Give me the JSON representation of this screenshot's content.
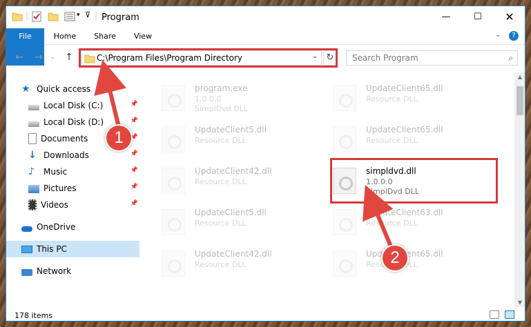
{
  "window": {
    "title": "Program"
  },
  "ribbon": {
    "tabs": [
      "File",
      "Home",
      "Share",
      "View"
    ]
  },
  "address": {
    "path": "C:\\Program Files\\Program Directory"
  },
  "search": {
    "placeholder": "Search Program"
  },
  "nav": {
    "items": [
      {
        "label": "Quick access",
        "icon": "star-icon",
        "pinned": false
      },
      {
        "label": "Local Disk (C:)",
        "icon": "drive-icon",
        "pinned": true
      },
      {
        "label": "Local Disk (D:)",
        "icon": "drive-icon",
        "pinned": true
      },
      {
        "label": "Documents",
        "icon": "document-icon",
        "pinned": true
      },
      {
        "label": "Downloads",
        "icon": "download-icon",
        "pinned": true
      },
      {
        "label": "Music",
        "icon": "music-icon",
        "pinned": true
      },
      {
        "label": "Pictures",
        "icon": "pictures-icon",
        "pinned": true
      },
      {
        "label": "Videos",
        "icon": "video-icon",
        "pinned": true
      },
      {
        "label": "OneDrive",
        "icon": "cloud-icon",
        "pinned": false
      },
      {
        "label": "This PC",
        "icon": "computer-icon",
        "pinned": false,
        "selected": true
      },
      {
        "label": "Network",
        "icon": "network-icon",
        "pinned": false
      }
    ]
  },
  "files": [
    {
      "name": "program.exe",
      "line2": "1.0.0.0",
      "line3": "SimplDvd DLL"
    },
    {
      "name": "UpdateClient65.dll",
      "line2": "Resource DLL",
      "line3": ""
    },
    {
      "name": "UpdateClient5.dll",
      "line2": "Resource DLL",
      "line3": ""
    },
    {
      "name": "UpdateClient65.dll",
      "line2": "Resource DLL",
      "line3": ""
    },
    {
      "name": "UpdateClient42.dll",
      "line2": "Resource DLL",
      "line3": ""
    },
    {
      "name": "simpldvd.dll",
      "line2": "1.0.0.0",
      "line3": "SimplDvd DLL"
    },
    {
      "name": "UpdateClient5.dll",
      "line2": "Resource DLL",
      "line3": ""
    },
    {
      "name": "UpdateClient63.dll",
      "line2": "Resource DLL",
      "line3": ""
    },
    {
      "name": "UpdateClient42.dll",
      "line2": "Resource DLL",
      "line3": ""
    },
    {
      "name": "UpdateClient65.dll",
      "line2": "Resource DLL",
      "line3": ""
    }
  ],
  "status": {
    "items": "178 items"
  },
  "callouts": {
    "one": "1",
    "two": "2"
  },
  "colors": {
    "accent": "#1979ca",
    "highlight": "#d53a3a",
    "callout": "#e0473f"
  }
}
